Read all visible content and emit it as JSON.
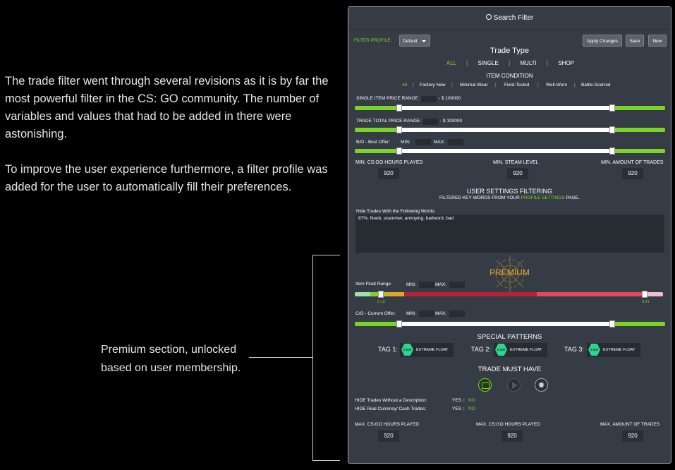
{
  "caption": {
    "para1": "The trade filter went through several revisions as it is by far the most powerful filter in the CS: GO community. The number of variables and values that had to be added in there were astonishing.",
    "para2": "To improve the user experience furthermore, a filter profile was added for the user to automatically fill their preferences.",
    "annotation": "Premium section, unlocked based on user membership."
  },
  "panel": {
    "title": "Search Filter",
    "filter_profile_label": "FILTER PROFILE:",
    "profile_select": "Default",
    "apply_label": "Apply Changes",
    "save_label": "Save",
    "new_label": "New",
    "trade_type_title": "Trade Type",
    "trade_types": [
      "ALL",
      "SINGLE",
      "MULTI",
      "SHOP"
    ],
    "item_condition_title": "ITEM CONDITION",
    "conditions": [
      "All",
      "Factory New",
      "Minimal Wear",
      "Field-Tested",
      "Well-Worn",
      "Battle-Scarred"
    ],
    "single_price_label": "SINGLE ITEM PRICE RANGE : $0",
    "single_price_max": "- $ 100000",
    "total_price_label": "TRADE TOTAL PRICE RANGE : $0",
    "total_price_max": "- $ 100000",
    "bo_label": "B/O - Best Offer:",
    "min_label": "MIN:",
    "max_label": "MAX:",
    "min_stats": [
      {
        "label": "MIN. CS:GO HOURS PLAYED",
        "value": "920"
      },
      {
        "label": "MIN. STEAM LEVEL",
        "value": "920"
      },
      {
        "label": "MIN. AMOUNT OF TRADES",
        "value": "920"
      }
    ],
    "user_settings_title": "USER SETTINGS FILTERING",
    "user_settings_sub_pre": "FILTERED KEY WORDS FROM YOUR",
    "user_settings_link": "PROFILE SETTINGS",
    "user_settings_sub_post": "PAGE.",
    "hide_words_label": "Hide Trades With the Following Words:",
    "hide_words_value": "87%, Noob, scammer, annoying, badword, bad",
    "premium_label": "PREMIUM",
    "float_label": "Item Float Range:",
    "float_min_value": "0.13",
    "float_max_value": "0.91",
    "co_label": "C/O - Current Offer:",
    "special_patterns_title": "SPECIAL PATTERNS",
    "tags": [
      {
        "label": "TAG 1:",
        "badge": "0.000",
        "text": "EXTREME FLOAT"
      },
      {
        "label": "TAG 2:",
        "badge": "0.000",
        "text": "EXTREME FLOAT"
      },
      {
        "label": "TAG 3:",
        "badge": "0.000",
        "text": "EXTREME FLOAT"
      }
    ],
    "must_have_title": "TRADE MUST HAVE",
    "must_have_icons": [
      "image-icon",
      "play-icon",
      "gear-badge-icon"
    ],
    "hide_desc_label": "HIDE Trades Without a Description:",
    "hide_cash_label": "HIDE Real Currency/ Cash Trades:",
    "yes_label": "YES",
    "no_label": "NO",
    "max_stats": [
      {
        "label": "MAX. CS:GO HOURS PLAYED",
        "value": "920"
      },
      {
        "label": "MAX. CS:GO HOURS PLAYED",
        "value": "920"
      },
      {
        "label": "MAX. AMOUNT OF TRADES",
        "value": "920"
      }
    ]
  },
  "colors": {
    "accent_green": "#7cd42a",
    "panel_bg": "#353c45",
    "premium_gold": "#e0a52a",
    "tag_teal": "#2fd48f"
  }
}
